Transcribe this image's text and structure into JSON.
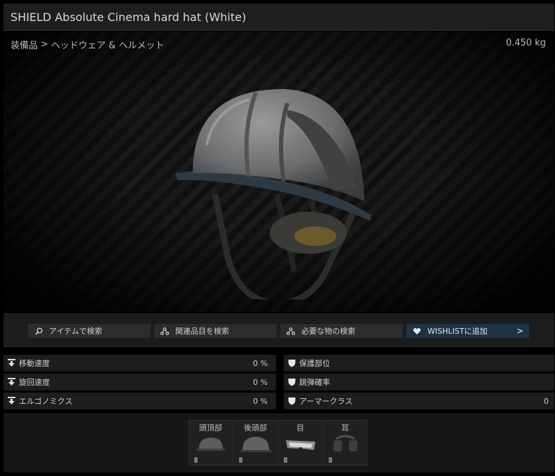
{
  "window": {
    "title": "SHIELD Absolute Cinema hard hat (White)"
  },
  "breadcrumb": {
    "category": "装備品",
    "separator": ">",
    "subcategory": "ヘッドウェア & ヘルメット"
  },
  "item": {
    "weight": "0.450 kg"
  },
  "actions": [
    {
      "label": "アイテムで検索",
      "icon": "magnifier-icon"
    },
    {
      "label": "関連品目を検索",
      "icon": "network-icon"
    },
    {
      "label": "必要な物の検索",
      "icon": "network-icon"
    },
    {
      "label": "WISHLISTに追加",
      "icon": "heart-icon",
      "trailing": ">"
    }
  ],
  "stats_left": [
    {
      "label": "移動速度",
      "value": "0 %"
    },
    {
      "label": "旋回速度",
      "value": "0 %"
    },
    {
      "label": "エルゴノミクス",
      "value": "0 %"
    }
  ],
  "stats_right": [
    {
      "label": "保護部位",
      "value": ""
    },
    {
      "label": "跳弾確率",
      "value": ""
    },
    {
      "label": "アーマークラス",
      "value": "0"
    }
  ],
  "slots": [
    {
      "label": "頭頂部",
      "icon": "cap-icon"
    },
    {
      "label": "後頭部",
      "icon": "helmet-icon"
    },
    {
      "label": "目",
      "icon": "goggles-icon"
    },
    {
      "label": "耳",
      "icon": "headset-icon"
    }
  ],
  "colors": {
    "accent": "#1f3347",
    "panel": "#1b1d1e",
    "background": "#000000"
  }
}
